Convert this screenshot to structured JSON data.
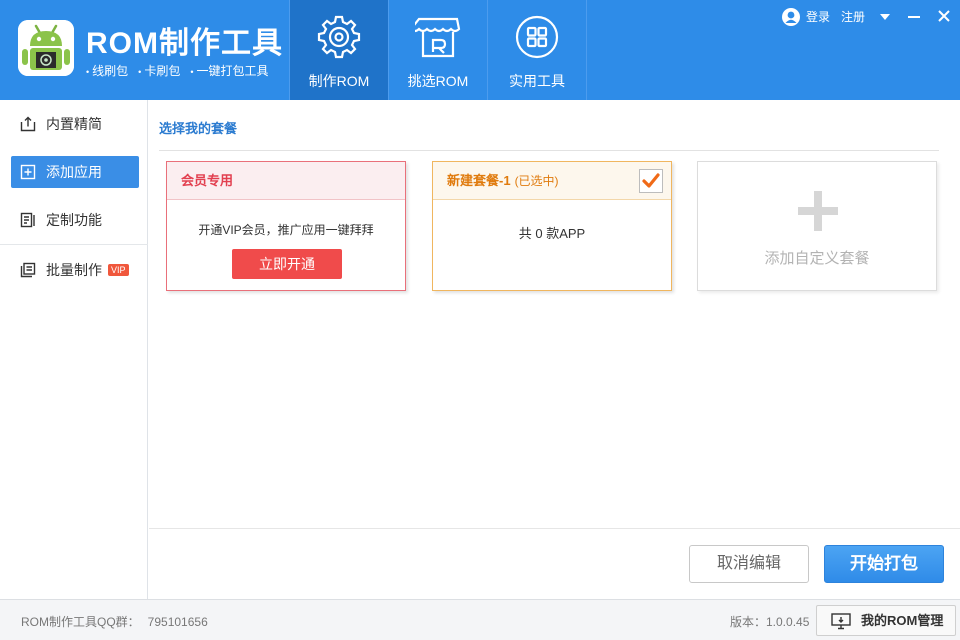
{
  "app": {
    "title": "ROM制作工具",
    "taglines": [
      "线刷包",
      "卡刷包",
      "一键打包工具"
    ]
  },
  "nav": {
    "tabs": [
      {
        "label": "制作ROM",
        "icon": "gear-icon",
        "active": true
      },
      {
        "label": "挑选ROM",
        "icon": "store-icon",
        "active": false
      },
      {
        "label": "实用工具",
        "icon": "grid-icon",
        "active": false
      }
    ]
  },
  "top_right": {
    "login": "登录",
    "register": "注册"
  },
  "sidebar": {
    "items": [
      {
        "label": "内置精简",
        "icon": "export-icon",
        "active": false
      },
      {
        "label": "添加应用",
        "icon": "add-box-icon",
        "active": true
      },
      {
        "label": "定制功能",
        "icon": "doc-settings-icon",
        "active": false
      },
      {
        "label": "批量制作",
        "icon": "batch-icon",
        "active": false,
        "badge": "VIP"
      }
    ]
  },
  "main": {
    "section_title": "选择我的套餐",
    "vip_card": {
      "title": "会员专用",
      "desc": "开通VIP会员，推广应用一键拜拜",
      "button": "立即开通"
    },
    "package_card": {
      "name": "新建套餐-1",
      "status": "(已选中)",
      "desc": "共 0 款APP",
      "checked": true
    },
    "add_card": {
      "label": "添加自定义套餐"
    },
    "buttons": {
      "cancel": "取消编辑",
      "start": "开始打包"
    }
  },
  "footer": {
    "qq_label": "ROM制作工具QQ群：",
    "qq_number": "795101656",
    "version": "版本：1.0.0.45",
    "manage_button": "我的ROM管理"
  },
  "colors": {
    "header_blue": "#2e8ce8",
    "active_tab": "#1f73c9",
    "accent_red": "#f04b4b",
    "accent_orange": "#e07b0e"
  }
}
